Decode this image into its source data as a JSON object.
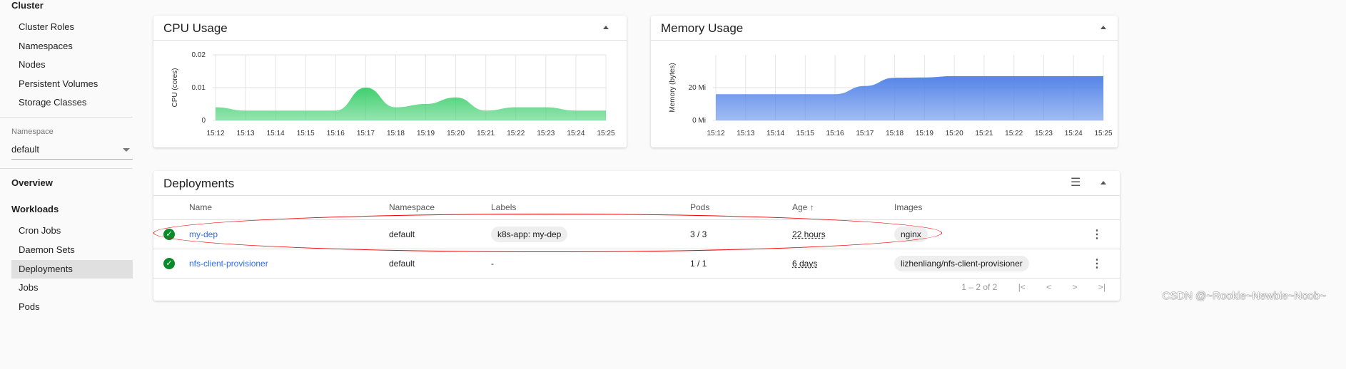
{
  "sidebar": {
    "cluster_header": "Cluster",
    "cluster_items": [
      "Cluster Roles",
      "Namespaces",
      "Nodes",
      "Persistent Volumes",
      "Storage Classes"
    ],
    "namespace_label": "Namespace",
    "namespace_value": "default",
    "overview": "Overview",
    "workloads": "Workloads",
    "workload_items": [
      "Cron Jobs",
      "Daemon Sets",
      "Deployments",
      "Jobs",
      "Pods"
    ],
    "active": "Deployments"
  },
  "cpu": {
    "title": "CPU Usage",
    "chart_data": {
      "type": "area",
      "x": [
        "15:12",
        "15:13",
        "15:14",
        "15:15",
        "15:16",
        "15:17",
        "15:18",
        "15:19",
        "15:20",
        "15:21",
        "15:22",
        "15:23",
        "15:24",
        "15:25"
      ],
      "values": [
        0.004,
        0.003,
        0.003,
        0.003,
        0.003,
        0.01,
        0.004,
        0.005,
        0.007,
        0.003,
        0.004,
        0.004,
        0.003,
        0.003
      ],
      "ylabel": "CPU (cores)",
      "yticks": [
        "0",
        "0.01",
        "0.02"
      ],
      "ylim": [
        0,
        0.02
      ],
      "color": "#3fcf6f",
      "grid": true
    }
  },
  "memory": {
    "title": "Memory Usage",
    "chart_data": {
      "type": "area",
      "x": [
        "15:12",
        "15:13",
        "15:14",
        "15:15",
        "15:16",
        "15:17",
        "15:18",
        "15:19",
        "15:20",
        "15:21",
        "15:22",
        "15:23",
        "15:24",
        "15:25"
      ],
      "values": [
        16,
        16,
        16,
        16,
        16,
        21,
        26,
        26.2,
        27,
        27,
        27,
        27,
        27,
        27
      ],
      "ylabel": "Memory (bytes)",
      "yticks": [
        "0 Mi",
        "20 Mi"
      ],
      "ylim": [
        0,
        40
      ],
      "unit": "Mi",
      "color": "#5585e8",
      "grid": true
    }
  },
  "deployments": {
    "title": "Deployments",
    "columns": [
      "Name",
      "Namespace",
      "Labels",
      "Pods",
      "Age",
      "Images"
    ],
    "rows": [
      {
        "name": "my-dep",
        "namespace": "default",
        "labels": "k8s-app: my-dep",
        "pods": "3 / 3",
        "age": "22 hours",
        "images": "nginx",
        "status": "ok"
      },
      {
        "name": "nfs-client-provisioner",
        "namespace": "default",
        "labels": "-",
        "pods": "1 / 1",
        "age": "6 days",
        "images": "lizhenliang/nfs-client-provisioner",
        "status": "ok"
      }
    ],
    "pagination": "1 – 2 of 2",
    "sort_icon": "arrow-up"
  },
  "watermark": "CSDN @~Rookie~Newbie~Noob~"
}
